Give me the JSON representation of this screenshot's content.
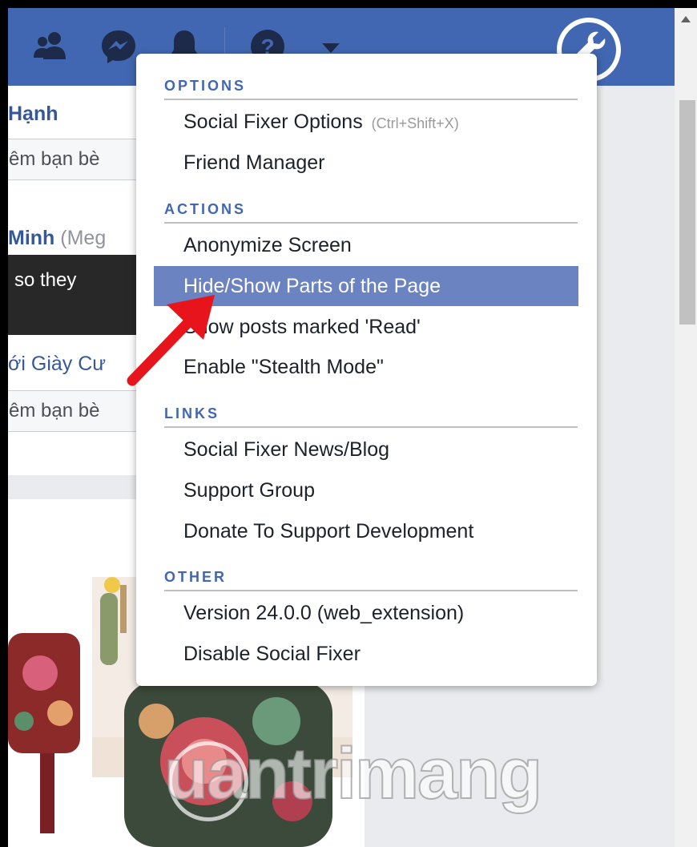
{
  "topbar": {
    "icons": [
      "friends-icon",
      "messenger-icon",
      "bell-icon",
      "help-icon",
      "caret-down-icon",
      "wrench-icon"
    ]
  },
  "background_page": {
    "person1_name": "Hạnh",
    "add_friend_label_1": "êm bạn bè",
    "person2_name": "Minh",
    "person2_extra": "(Meg",
    "tooltip_text": "so they",
    "person3_name": "ới Giày Cư",
    "add_friend_label_2": "êm bạn bè",
    "watermark_text": "uantrimang"
  },
  "menu": {
    "sections": [
      {
        "header": "OPTIONS",
        "items": [
          {
            "label": "Social Fixer Options",
            "shortcut": "(Ctrl+Shift+X)"
          },
          {
            "label": "Friend Manager"
          }
        ]
      },
      {
        "header": "ACTIONS",
        "items": [
          {
            "label": "Anonymize Screen"
          },
          {
            "label": "Hide/Show Parts of the Page",
            "selected": true
          },
          {
            "label": "Show posts marked 'Read'"
          },
          {
            "label": "Enable \"Stealth Mode\""
          }
        ]
      },
      {
        "header": "LINKS",
        "items": [
          {
            "label": "Social Fixer News/Blog"
          },
          {
            "label": "Support Group"
          },
          {
            "label": "Donate To Support Development"
          }
        ]
      },
      {
        "header": "OTHER",
        "items": [
          {
            "label": "Version 24.0.0 (web_extension)"
          },
          {
            "label": "Disable Social Fixer"
          }
        ]
      }
    ]
  },
  "colors": {
    "facebook_blue": "#4267b2",
    "selected_bg": "#6b83c1",
    "header_text": "#4267b2",
    "annotation_arrow": "#e8141b"
  }
}
